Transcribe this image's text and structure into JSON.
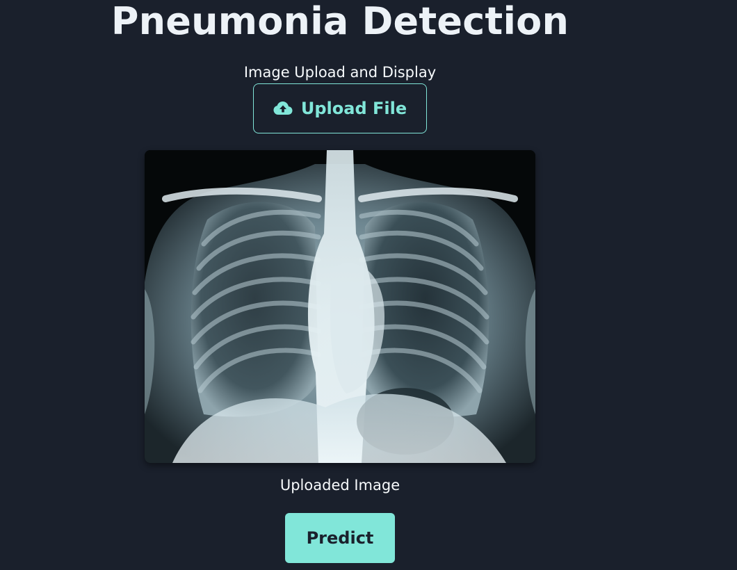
{
  "header": {
    "title": "Pneumonia Detection",
    "subtitle": "Image Upload and Display"
  },
  "upload": {
    "label": "Upload File",
    "icon": "cloud-upload-icon"
  },
  "preview": {
    "caption": "Uploaded Image",
    "image_subject": "chest-xray"
  },
  "actions": {
    "predict_label": "Predict"
  },
  "colors": {
    "background": "#1a202c",
    "accent": "#81e6d9",
    "text": "#f7fafc"
  }
}
